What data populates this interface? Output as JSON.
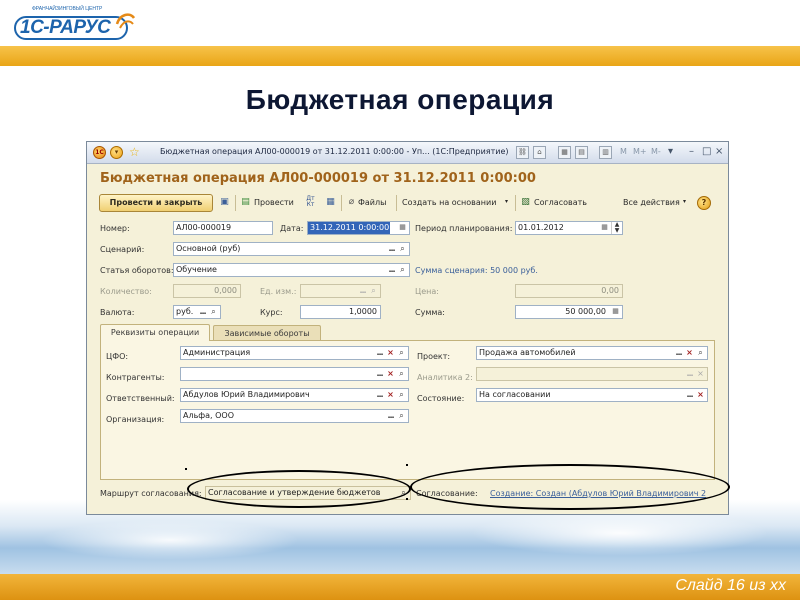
{
  "logo": {
    "text": "1С-РАРУС",
    "tagline": "ФРАНЧАЙЗИНГОВЫЙ ЦЕНТР"
  },
  "slide": {
    "title": "Бюджетная операция",
    "number": "Слайд 16 из хх"
  },
  "window": {
    "caption": "Бюджетная операция АЛ00-000019 от 31.12.2011 0:00:00 - Уп...  (1С:Предприятие)",
    "memory_buttons": [
      "M",
      "M+",
      "M-"
    ],
    "form_title": "Бюджетная операция АЛ00-000019 от 31.12.2011 0:00:00"
  },
  "toolbar": {
    "post_close": "Провести и закрыть",
    "post": "Провести",
    "dt_kt": "Дт Кт",
    "files": "Файлы",
    "create_based": "Создать на основании",
    "approve": "Согласовать",
    "all_actions": "Все действия"
  },
  "header_fields": {
    "number_label": "Номер:",
    "number_value": "АЛ00-000019",
    "date_label": "Дата:",
    "date_value": "31.12.2011  0:00:00",
    "period_label": "Период планирования:",
    "period_value": "01.01.2012",
    "scenario_label": "Сценарий:",
    "scenario_value": "Основной (руб)",
    "article_label": "Статья оборотов:",
    "article_value": "Обучение",
    "scenario_sum": "Сумма сценария: 50 000 руб.",
    "qty_label": "Количество:",
    "qty_value": "0,000",
    "unit_label": "Ед. изм.:",
    "unit_value": "",
    "price_label": "Цена:",
    "price_value": "0,00",
    "currency_label": "Валюта:",
    "currency_value": "руб.",
    "rate_label": "Курс:",
    "rate_value": "1,0000",
    "amount_label": "Сумма:",
    "amount_value": "50 000,00"
  },
  "tabs": [
    {
      "label": "Реквизиты операции",
      "active": true
    },
    {
      "label": "Зависимые обороты",
      "active": false
    }
  ],
  "details": {
    "cfo_label": "ЦФО:",
    "cfo_value": "Администрация",
    "contractors_label": "Контрагенты:",
    "contractors_value": "",
    "responsible_label": "Ответственный:",
    "responsible_value": "Абдулов Юрий Владимирович",
    "organization_label": "Организация:",
    "organization_value": "Альфа, ООО",
    "project_label": "Проект:",
    "project_value": "Продажа автомобилей",
    "analytics2_label": "Аналитика 2:",
    "analytics2_value": "",
    "state_label": "Состояние:",
    "state_value": "На согласовании"
  },
  "route": {
    "label": "Маршрут согласования:",
    "value": "Согласование и утверждение бюджетов",
    "approval_label": "Согласование:",
    "approval_link": "Создание: Создан (Абдулов Юрий Владимирович 2"
  },
  "colors": {
    "header_band": "#e9a516",
    "form_title": "#a0631b",
    "form_bg": "#f5f1d9",
    "link": "#3a5f9a",
    "selection": "#3365b8"
  }
}
